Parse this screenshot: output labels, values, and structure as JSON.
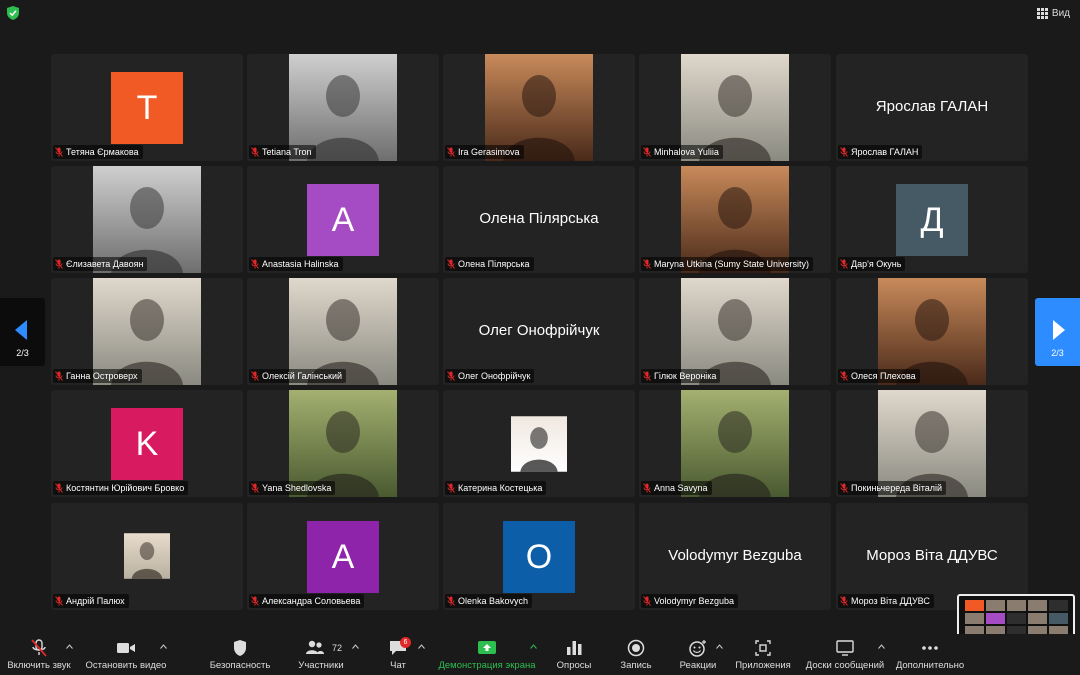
{
  "topbar": {
    "view_label": "Вид"
  },
  "colors": {
    "accent_blue": "#2d8cff",
    "share_green": "#2ebd4f",
    "mic_red": "#e02828"
  },
  "participants": [
    {
      "name": "Тетяна Єрмакова",
      "type": "avatar",
      "letter": "Т",
      "color": "#f15a24"
    },
    {
      "name": "Tetiana Tron",
      "type": "photo",
      "tone": "bw"
    },
    {
      "name": "Ira Gerasimova",
      "type": "photo",
      "tone": "warm"
    },
    {
      "name": "Minhalova Yuliia",
      "type": "photo",
      "tone": "light"
    },
    {
      "name": "Ярослав ГАЛАН",
      "type": "text",
      "display": "Ярослав ГАЛАН"
    },
    {
      "name": "Єлизавета  Давоян",
      "type": "photo",
      "tone": "bw"
    },
    {
      "name": "Anastasia Halinska",
      "type": "avatar",
      "letter": "A",
      "color": "#a54cc4"
    },
    {
      "name": "Олена Пілярська",
      "type": "text",
      "display": "Олена Пілярська"
    },
    {
      "name": "Maryna Utkina (Sumy State University)",
      "type": "photo",
      "tone": "warm"
    },
    {
      "name": "Дар'я Окунь",
      "type": "avatar",
      "letter": "Д",
      "color": "#455a64"
    },
    {
      "name": "Ганна Островерх",
      "type": "photo",
      "tone": "light"
    },
    {
      "name": "Олексій Галінський",
      "type": "photo",
      "tone": "light"
    },
    {
      "name": "Олег Онофрійчук",
      "type": "text",
      "display": "Олег Онофрійчук"
    },
    {
      "name": "Гілюк Вероніка",
      "type": "photo",
      "tone": "light"
    },
    {
      "name": "Олеся Плехова",
      "type": "photo",
      "tone": "warm"
    },
    {
      "name": "Костянтин Юрійович Бровко",
      "type": "avatar",
      "letter": "K",
      "color": "#d81b60"
    },
    {
      "name": "Yana  Shedlovska",
      "type": "photo",
      "tone": "nature"
    },
    {
      "name": "Катерина Костецька",
      "type": "photo",
      "tone": "portrait-small"
    },
    {
      "name": "Anna Savyna",
      "type": "photo",
      "tone": "nature"
    },
    {
      "name": "Покиньчереда Віталій",
      "type": "photo",
      "tone": "light"
    },
    {
      "name": "Андрій Палюх",
      "type": "photo",
      "tone": "portrait-small2"
    },
    {
      "name": "Александра Соловьева",
      "type": "avatar",
      "letter": "A",
      "color": "#8e24aa"
    },
    {
      "name": "Olenka Bakovych",
      "type": "avatar",
      "letter": "O",
      "color": "#0d5ea8"
    },
    {
      "name": "Volodymyr Bezguba",
      "type": "text",
      "display": "Volodymyr Bezguba"
    },
    {
      "name": "Мороз Віта  ДДУВС",
      "type": "text",
      "display": "Мороз Віта  ДДУВС"
    }
  ],
  "nav": {
    "left_page": "2/3",
    "right_page": "2/3"
  },
  "toolbar": {
    "unmute": "Включить звук",
    "stop_video": "Остановить видео",
    "security": "Безопасность",
    "participants": "Участники",
    "participants_count": "72",
    "chat": "Чат",
    "chat_badge": "6",
    "share": "Демонстрация экрана",
    "polls": "Опросы",
    "record": "Запись",
    "reactions": "Реакции",
    "apps": "Приложения",
    "whiteboards": "Доски сообщений",
    "more": "Дополнительно"
  }
}
